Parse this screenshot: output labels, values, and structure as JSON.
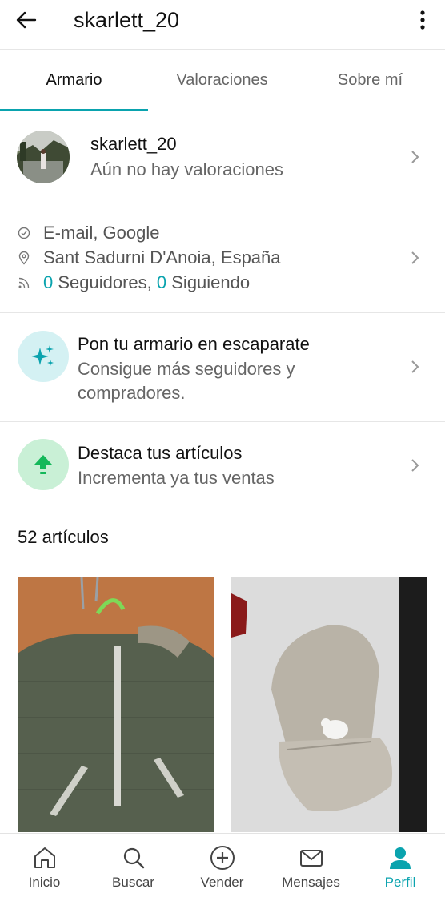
{
  "header": {
    "title": "skarlett_20"
  },
  "tabs": [
    {
      "label": "Armario"
    },
    {
      "label": "Valoraciones"
    },
    {
      "label": "Sobre mí"
    }
  ],
  "profile": {
    "username": "skarlett_20",
    "rating_text": "Aún no hay valoraciones"
  },
  "info": {
    "verified": "E-mail, Google",
    "location": "Sant Sadurni D'Anoia, España",
    "followers_count": "0",
    "followers_label": " Seguidores, ",
    "following_count": "0",
    "following_label": " Siguiendo"
  },
  "promo_closet": {
    "title": "Pon tu armario en escaparate",
    "subtitle_line1": "Consigue más seguidores y",
    "subtitle_line2": "compradores."
  },
  "promo_boost": {
    "title": "Destaca tus artículos",
    "subtitle": "Incrementa ya tus ventas"
  },
  "items": {
    "count_label": "52 artículos"
  },
  "bottom_nav": [
    {
      "label": "Inicio",
      "icon": "home-icon"
    },
    {
      "label": "Buscar",
      "icon": "search-icon"
    },
    {
      "label": "Vender",
      "icon": "plus-circle-icon"
    },
    {
      "label": "Mensajes",
      "icon": "mail-icon"
    },
    {
      "label": "Perfil",
      "icon": "person-icon"
    }
  ],
  "colors": {
    "accent": "#0aa3ae",
    "promo_blue_bg": "#d4f1f3",
    "promo_green_bg": "#c9f0d6",
    "promo_green_icon": "#14b85a"
  }
}
